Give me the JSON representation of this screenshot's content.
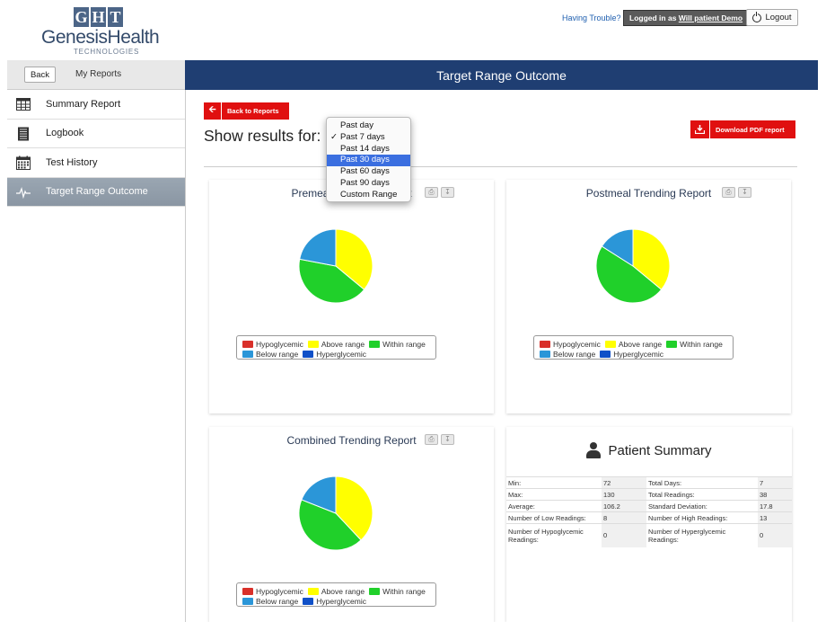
{
  "header": {
    "logo": {
      "letters": [
        "G",
        "H",
        "T"
      ],
      "name": "GenesisHealth",
      "sub": "TECHNOLOGIES"
    },
    "trouble_link": "Having Trouble?",
    "logged_in_prefix": "Logged in as",
    "user_name": "Will patient Demo",
    "logout_label": "Logout",
    "logout_icon": "power-icon"
  },
  "sidebar": {
    "back_label": "Back",
    "section_label": "My Reports",
    "items": [
      {
        "label": "Summary Report",
        "icon": "table-icon",
        "active": false
      },
      {
        "label": "Logbook",
        "icon": "notebook-icon",
        "active": false
      },
      {
        "label": "Test History",
        "icon": "calendar-icon",
        "active": false
      },
      {
        "label": "Target Range Outcome",
        "icon": "pulse-icon",
        "active": true
      }
    ]
  },
  "main": {
    "title": "Target Range Outcome",
    "back_to_reports": "Back to Reports",
    "show_results_label": "Show results for:",
    "download_pdf": "Download PDF report",
    "range_options": [
      "Past day",
      "Past 7 days",
      "Past 14 days",
      "Past 30 days",
      "Past 60 days",
      "Past 90 days",
      "Custom Range"
    ],
    "checked_option": "Past 7 days",
    "highlighted_option": "Past 30 days",
    "check_mark": "✓"
  },
  "legend": {
    "hypoglycemic": "Hypoglycemic",
    "above": "Above range",
    "within": "Within range",
    "below": "Below range",
    "hyperglycemic": "Hyperglycemic"
  },
  "colors": {
    "hypoglycemic": "#d9302a",
    "above": "#ffff00",
    "within": "#20d02a",
    "below": "#2b96d8",
    "hyperglycemic": "#1050c8",
    "title_bar": "#1f3e72",
    "button_red": "#e01010"
  },
  "chart_data": [
    {
      "type": "pie",
      "title": "Premeal Trending Report",
      "categories": [
        "Above range",
        "Within range",
        "Below range"
      ],
      "values": [
        36,
        42,
        22
      ]
    },
    {
      "type": "pie",
      "title": "Postmeal Trending Report",
      "categories": [
        "Above range",
        "Within range",
        "Below range"
      ],
      "values": [
        36,
        48,
        16
      ]
    },
    {
      "type": "pie",
      "title": "Combined Trending Report",
      "categories": [
        "Above range",
        "Within range",
        "Below range"
      ],
      "values": [
        38,
        43,
        19
      ]
    }
  ],
  "patient_summary": {
    "title": "Patient Summary",
    "rows": [
      {
        "l1": "Min:",
        "v1": "72",
        "l2": "Total Days:",
        "v2": "7"
      },
      {
        "l1": "Max:",
        "v1": "130",
        "l2": "Total Readings:",
        "v2": "38"
      },
      {
        "l1": "Average:",
        "v1": "106.2",
        "l2": "Standard Deviation:",
        "v2": "17.8"
      },
      {
        "l1": "Number of Low Readings:",
        "v1": "8",
        "l2": "Number of High Readings:",
        "v2": "13"
      },
      {
        "l1": "Number of Hypoglycemic Readings:",
        "v1": "0",
        "l2": "Number of Hyperglycemic Readings:",
        "v2": "0"
      }
    ]
  }
}
